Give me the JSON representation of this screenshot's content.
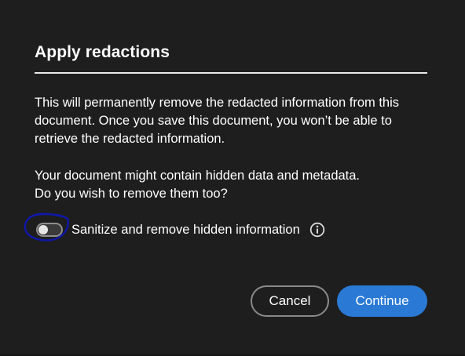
{
  "dialog": {
    "title": "Apply redactions",
    "paragraph1": [
      "This will permanently remove the redacted information from this",
      "document. Once you save this document, you won’t be able to",
      "retrieve the redacted information."
    ],
    "paragraph2": [
      "Your document might contain hidden data and metadata.",
      "Do you wish to remove them too?"
    ],
    "sanitize_toggle": {
      "label": "Sanitize and remove hidden information",
      "checked": false,
      "info_icon": "info-icon"
    },
    "buttons": {
      "cancel": "Cancel",
      "continue": "Continue"
    }
  },
  "colors": {
    "background": "#1e1e1e",
    "text": "#ffffff",
    "primary": "#2a7ad5",
    "annotation": "#0f18a8"
  }
}
